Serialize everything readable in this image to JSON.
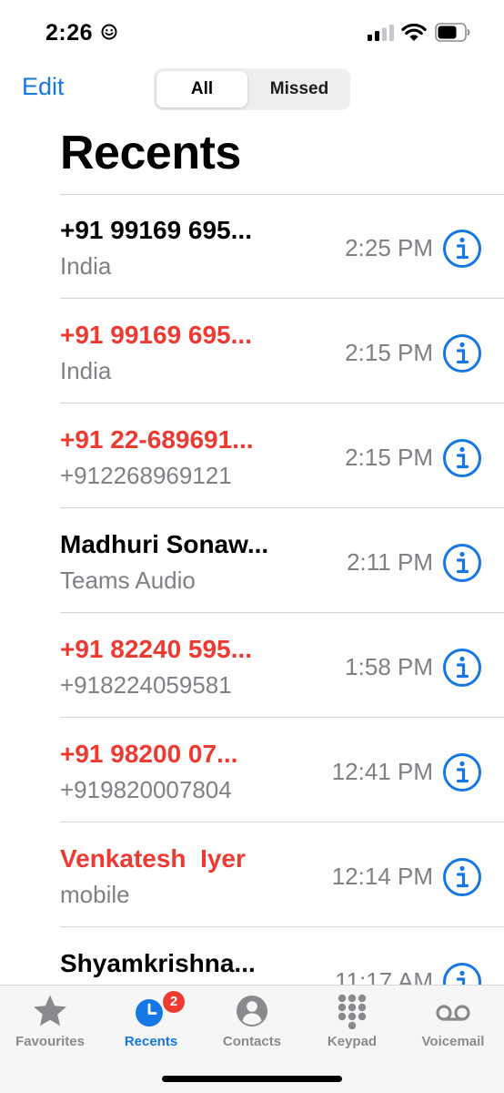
{
  "status_bar": {
    "time": "2:26"
  },
  "header": {
    "edit_label": "Edit",
    "segments": [
      {
        "label": "All",
        "selected": true
      },
      {
        "label": "Missed",
        "selected": false
      }
    ],
    "title": "Recents"
  },
  "colors": {
    "accent": "#1677e6",
    "missed": "#ee3a30",
    "secondary_text": "#808086"
  },
  "calls": [
    {
      "name": "+91 99169 695...",
      "sub": "India",
      "time": "2:25 PM",
      "missed": false
    },
    {
      "name": "+91 99169 695...",
      "sub": "India",
      "time": "2:15 PM",
      "missed": true
    },
    {
      "name": "+91 22-689691...",
      "sub": "+912268969121",
      "time": "2:15 PM",
      "missed": true
    },
    {
      "name": "Madhuri Sonaw...",
      "sub": "Teams Audio",
      "time": "2:11 PM",
      "missed": false
    },
    {
      "name": "+91 82240 595...",
      "sub": "+918224059581",
      "time": "1:58 PM",
      "missed": true
    },
    {
      "name": "+91 98200 07...",
      "sub": "+919820007804",
      "time": "12:41 PM",
      "missed": true
    },
    {
      "name": "Venkatesh  Iyer",
      "sub": "mobile",
      "time": "12:14 PM",
      "missed": true
    },
    {
      "name": "Shyamkrishna...",
      "sub": "",
      "time": "11:17 AM",
      "missed": false
    }
  ],
  "tab_bar": {
    "tabs": [
      {
        "label": "Favourites",
        "icon": "star-icon",
        "active": false
      },
      {
        "label": "Recents",
        "icon": "clock-icon",
        "active": true,
        "badge": "2"
      },
      {
        "label": "Contacts",
        "icon": "person-icon",
        "active": false
      },
      {
        "label": "Keypad",
        "icon": "keypad-icon",
        "active": false
      },
      {
        "label": "Voicemail",
        "icon": "voicemail-icon",
        "active": false
      }
    ]
  }
}
